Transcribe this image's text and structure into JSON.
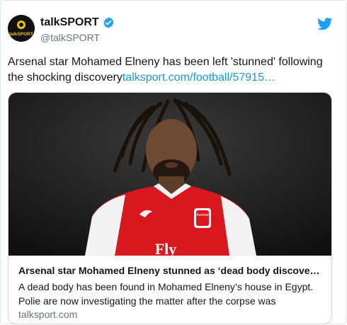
{
  "tweet": {
    "display_name": "talkSPORT",
    "handle": "@talkSPORT",
    "text": "Arsenal star Mohamed Elneny has been left 'stunned' following the shocking discovery",
    "link_text": "talksport.com/football/57915…",
    "avatar_text": "talkSPORT"
  },
  "card": {
    "title": "Arsenal star Mohamed Elneny stunned as ‘dead body discove…",
    "description": "A dead body has been found in Mohamed Elneny’s house in Egypt. Polie are now investigating the matter after the corpse was",
    "domain": "talksport.com",
    "image_badge_text": "Arsenal",
    "image_sponsor_text": "Fly"
  },
  "colors": {
    "twitter_blue": "#1da1f2",
    "link_blue": "#1b95e0",
    "shirt_red": "#d8181f",
    "shirt_white": "#f2f2f2"
  },
  "icons": [
    "verified-badge-icon",
    "twitter-bird-icon"
  ]
}
